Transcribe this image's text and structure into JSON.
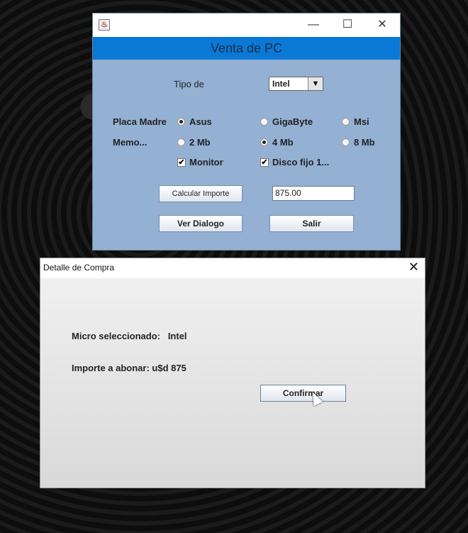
{
  "main_window": {
    "header_title": "Venta de PC",
    "controls": {
      "minimize": "—",
      "maximize": "☐",
      "close": "✕"
    },
    "tipo_label": "Tipo de",
    "tipo_select": {
      "value": "Intel",
      "arrow_icon": "▼"
    },
    "placa_label": "Placa Madre",
    "placa_options": [
      "Asus",
      "GigaByte",
      "Msi"
    ],
    "placa_selected": "Asus",
    "memo_label": "Memo...",
    "memo_options": [
      "2 Mb",
      "4 Mb",
      "8 Mb"
    ],
    "memo_selected": "4 Mb",
    "checkbox_monitor": {
      "label": "Monitor",
      "checked": true
    },
    "checkbox_disco": {
      "label": "Disco fijo 1...",
      "checked": true
    },
    "calc_button": "Calcular Importe",
    "importe_value": "875.00",
    "ver_dialogo_button": "Ver Dialogo",
    "salir_button": "Salir"
  },
  "dialog": {
    "title": "Detalle de Compra",
    "close": "✕",
    "micro_text": "Micro seleccionado:   Intel",
    "importe_text": "Importe a abonar: u$d 875",
    "confirm_button": "Confirmar"
  }
}
